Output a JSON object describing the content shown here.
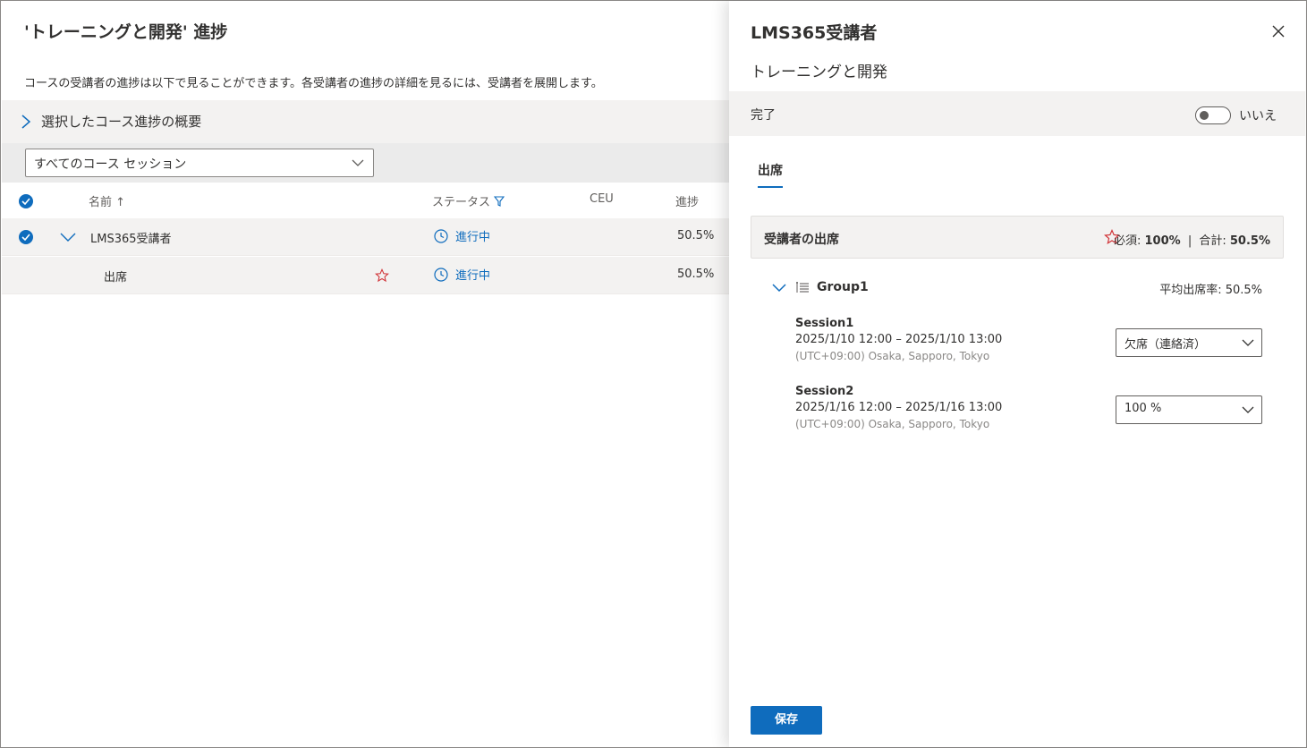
{
  "page": {
    "title": "'トレーニングと開発' 進捗",
    "description": "コースの受講者の進捗は以下で見ることができます。各受講者の進捗の詳細を見るには、受講者を展開します。",
    "summary_label": "選択したコース進捗の概要",
    "session_filter": "すべてのコース セッション"
  },
  "table": {
    "columns": {
      "name": "名前 ↑",
      "status": "ステータス",
      "ceu": "CEU",
      "progress": "進捗"
    },
    "rows": [
      {
        "name": "LMS365受講者",
        "status": "進行中",
        "progress": "50.5%",
        "selected": true,
        "expanded": true
      },
      {
        "name": "出席",
        "status": "進行中",
        "progress": "50.5%",
        "required": true
      }
    ]
  },
  "panel": {
    "title": "LMS365受講者",
    "subtitle": "トレーニングと開発",
    "complete_label": "完了",
    "complete_toggle_label": "いいえ",
    "complete_toggle_on": false,
    "tab": "出席",
    "attendance": {
      "title": "受講者の出席",
      "required_label": "必須:",
      "required_value": "100%",
      "separator": "|",
      "total_label": "合計:",
      "total_value": "50.5%"
    },
    "group": {
      "name": "Group1",
      "avg_label": "平均出席率: 50.5%"
    },
    "sessions": [
      {
        "name": "Session1",
        "time": "2025/1/10 12:00 – 2025/1/10 13:00",
        "tz": "(UTC+09:00) Osaka, Sapporo, Tokyo",
        "value": "欠席（連絡済）"
      },
      {
        "name": "Session2",
        "time": "2025/1/16 12:00 – 2025/1/16 13:00",
        "tz": "(UTC+09:00) Osaka, Sapporo, Tokyo",
        "value": "100 %"
      }
    ],
    "save_label": "保存"
  },
  "colors": {
    "accent": "#0f6cbd",
    "star": "#d13438",
    "panel_band": "#f3f2f1"
  }
}
